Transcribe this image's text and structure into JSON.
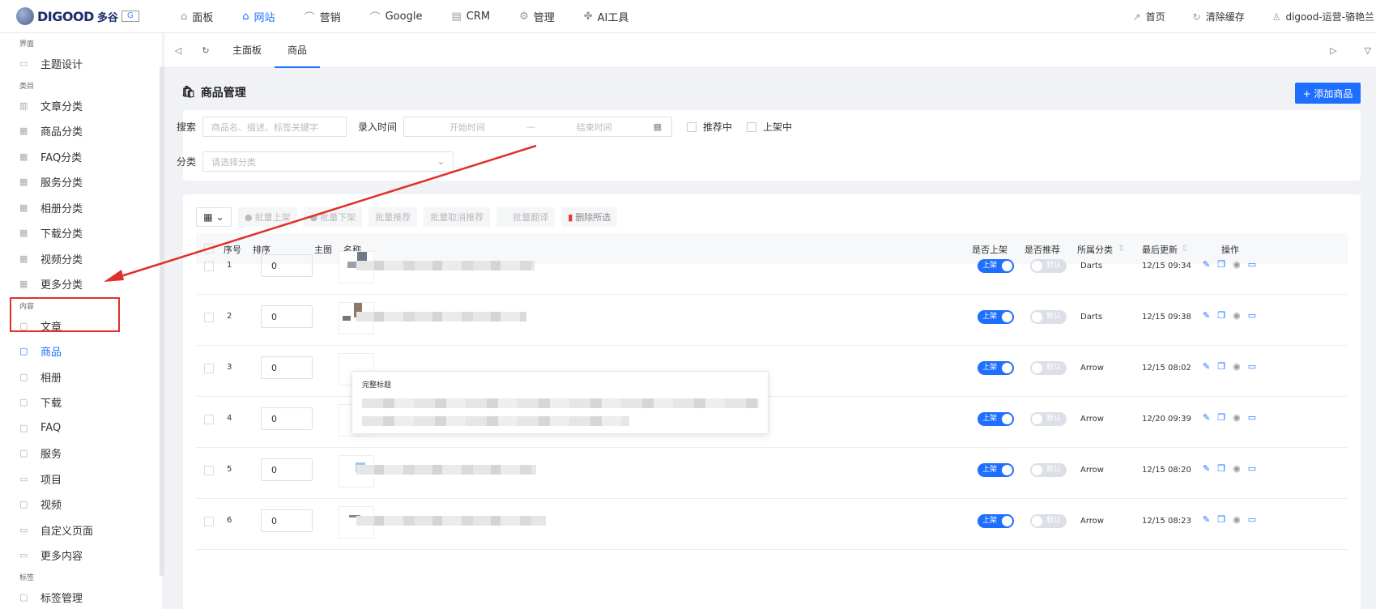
{
  "topnav": {
    "logo_text": "DIGOOD",
    "logo_cn": "多谷",
    "logo_badge": "G",
    "menu": [
      {
        "icon": "home-icon",
        "glyph": "⌂",
        "label": "面板"
      },
      {
        "icon": "building-icon",
        "glyph": "⌂",
        "label": "网站"
      },
      {
        "icon": "chart-icon",
        "glyph": "⌒",
        "label": "营销"
      },
      {
        "icon": "chart-icon",
        "glyph": "⌒",
        "label": "Google"
      },
      {
        "icon": "table-icon",
        "glyph": "▤",
        "label": "CRM"
      },
      {
        "icon": "gear-icon",
        "glyph": "⚙",
        "label": "管理"
      },
      {
        "icon": "ai-icon",
        "glyph": "✤",
        "label": "AI工具"
      }
    ],
    "active_index": 1,
    "right": {
      "home_link": "首页",
      "clear_cache": "清除缓存",
      "user": "digood-运营-骆艳兰"
    }
  },
  "sidebar": {
    "sections": [
      {
        "title": "界面",
        "items": [
          {
            "label": "主题设计",
            "icon": "monitor-icon",
            "glyph": "▭"
          }
        ]
      },
      {
        "title": "类目",
        "items": [
          {
            "label": "文章分类",
            "icon": "book-icon",
            "glyph": "▥"
          },
          {
            "label": "商品分类",
            "icon": "grid-icon",
            "glyph": "▦"
          },
          {
            "label": "FAQ分类",
            "icon": "grid-icon",
            "glyph": "▦"
          },
          {
            "label": "服务分类",
            "icon": "grid-icon",
            "glyph": "▦"
          },
          {
            "label": "相册分类",
            "icon": "grid-icon",
            "glyph": "▦"
          },
          {
            "label": "下载分类",
            "icon": "grid-icon",
            "glyph": "▦"
          },
          {
            "label": "视频分类",
            "icon": "grid-icon",
            "glyph": "▦"
          },
          {
            "label": "更多分类",
            "icon": "grid-icon",
            "glyph": "▦"
          }
        ]
      },
      {
        "title": "内容",
        "items": [
          {
            "label": "文章",
            "icon": "doc-icon",
            "glyph": "▢"
          },
          {
            "label": "商品",
            "icon": "doc-icon",
            "glyph": "▢",
            "active": true
          },
          {
            "label": "相册",
            "icon": "doc-icon",
            "glyph": "▢"
          },
          {
            "label": "下载",
            "icon": "doc-icon",
            "glyph": "▢"
          },
          {
            "label": "FAQ",
            "icon": "doc-icon",
            "glyph": "▢"
          },
          {
            "label": "服务",
            "icon": "doc-icon",
            "glyph": "▢"
          },
          {
            "label": "项目",
            "icon": "page-icon",
            "glyph": "▭"
          },
          {
            "label": "视频",
            "icon": "doc-icon",
            "glyph": "▢"
          },
          {
            "label": "自定义页面",
            "icon": "page-icon",
            "glyph": "▭"
          },
          {
            "label": "更多内容",
            "icon": "monitor-icon",
            "glyph": "▭"
          }
        ]
      },
      {
        "title": "标签",
        "items": [
          {
            "label": "标签管理",
            "icon": "tag-icon",
            "glyph": "▢"
          }
        ]
      }
    ]
  },
  "tabbar": {
    "back_glyph": "◁",
    "refresh_glyph": "↻",
    "tabs": [
      {
        "label": "主面板"
      },
      {
        "label": "商品",
        "active": true
      }
    ],
    "right_glyphs": [
      "▷",
      "▽"
    ]
  },
  "page": {
    "title": "商品管理",
    "add_button": "+ 添加商品"
  },
  "filter": {
    "search_label": "搜索",
    "search_placeholder": "商品名、描述、标签关键字",
    "time_label": "录入时间",
    "start_placeholder": "开始时间",
    "range_sep": "—",
    "end_placeholder": "结束时间",
    "chk_recommended": "推荐中",
    "chk_listed": "上架中",
    "category_label": "分类",
    "category_placeholder": "请选择分类"
  },
  "toolbar": {
    "grid_glyph": "▦",
    "buttons": [
      "批量上架",
      "批量下架",
      "批量推荐",
      "批量取消推荐",
      "批量翻译",
      "删除所选"
    ]
  },
  "table": {
    "headers": {
      "index": "序号",
      "sort": "排序",
      "image": "主图",
      "name": "名称",
      "listed": "是否上架",
      "recommended": "是否推荐",
      "category": "所属分类",
      "updated": "最后更新",
      "ops": "操作"
    },
    "on_label": "上架",
    "off_label": "默认",
    "rows": [
      {
        "index": "1",
        "sort": "0",
        "category": "Darts",
        "updated": "12/15 09:34"
      },
      {
        "index": "2",
        "sort": "0",
        "category": "Darts",
        "updated": "12/15 09:38"
      },
      {
        "index": "3",
        "sort": "0",
        "category": "Arrow",
        "updated": "12/15 08:02"
      },
      {
        "index": "4",
        "sort": "0",
        "category": "Arrow",
        "updated": "12/20 09:39"
      },
      {
        "index": "5",
        "sort": "0",
        "category": "Arrow",
        "updated": "12/15 08:20"
      },
      {
        "index": "6",
        "sort": "0",
        "category": "Arrow",
        "updated": "12/15 08:23"
      }
    ]
  },
  "tooltip": {
    "title": "完整标题"
  },
  "colors": {
    "primary": "#1e6fff",
    "annotation": "#e0302a"
  }
}
